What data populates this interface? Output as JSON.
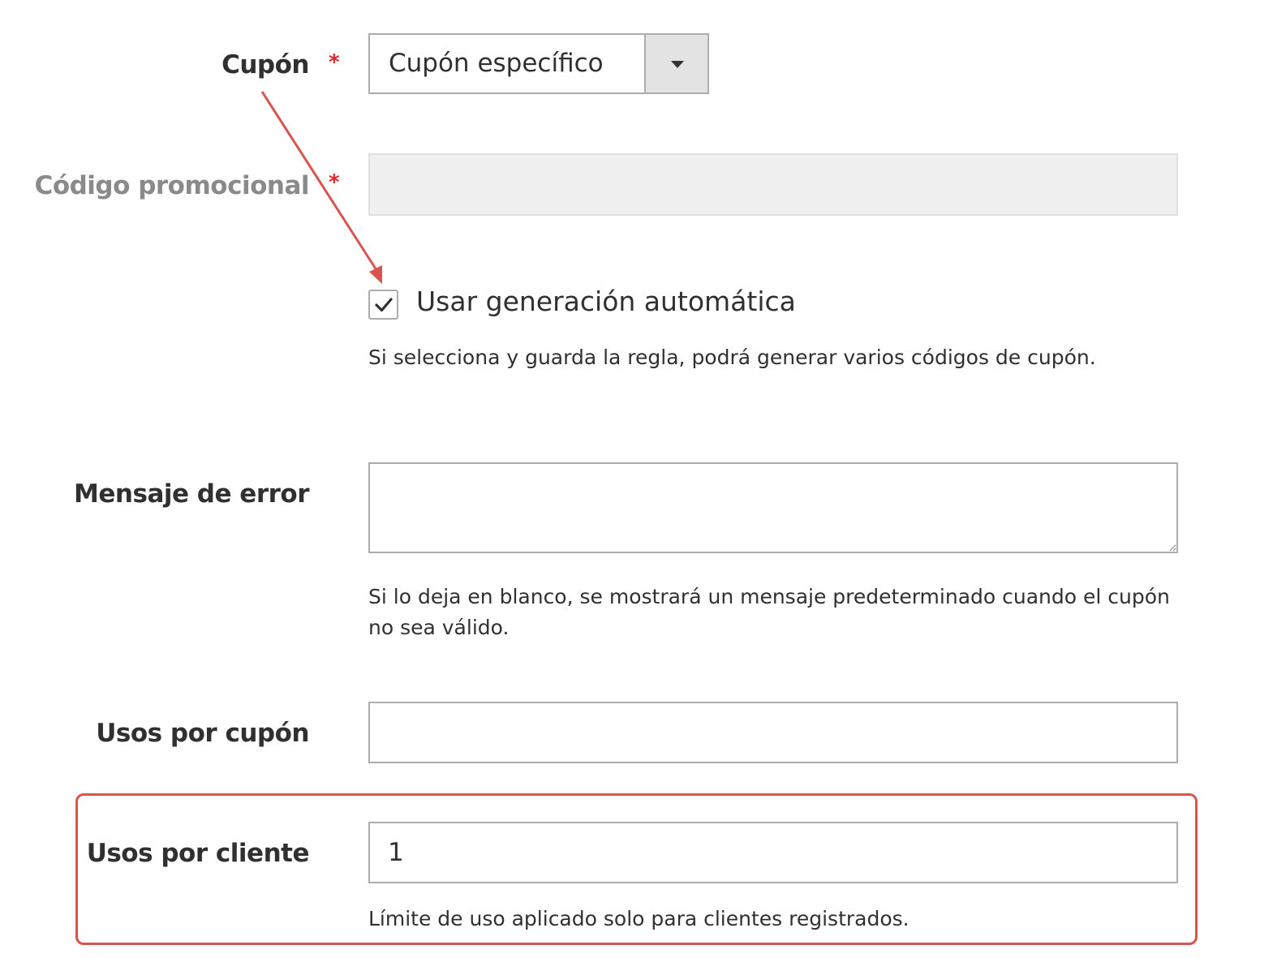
{
  "coupon": {
    "label": "Cupón",
    "required_mark": "*",
    "select_value": "Cupón específico"
  },
  "promo_code": {
    "label": "Código promocional",
    "required_mark": "*",
    "value": ""
  },
  "auto_generation": {
    "checked": true,
    "label": "Usar generación automática",
    "note": "Si selecciona y guarda la regla, podrá generar varios códigos de cupón."
  },
  "error_message": {
    "label": "Mensaje de error",
    "value": "",
    "note": "Si lo deja en blanco, se mostrará un mensaje predeterminado cuando el cupón no sea válido."
  },
  "uses_per_coupon": {
    "label": "Usos por cupón",
    "value": ""
  },
  "uses_per_customer": {
    "label": "Usos por cliente",
    "value": "1",
    "note": "Límite de uso aplicado solo para clientes registrados."
  },
  "colors": {
    "required": "#e22626",
    "annotation": "#d9534f",
    "label_muted": "#8a8a8a"
  }
}
